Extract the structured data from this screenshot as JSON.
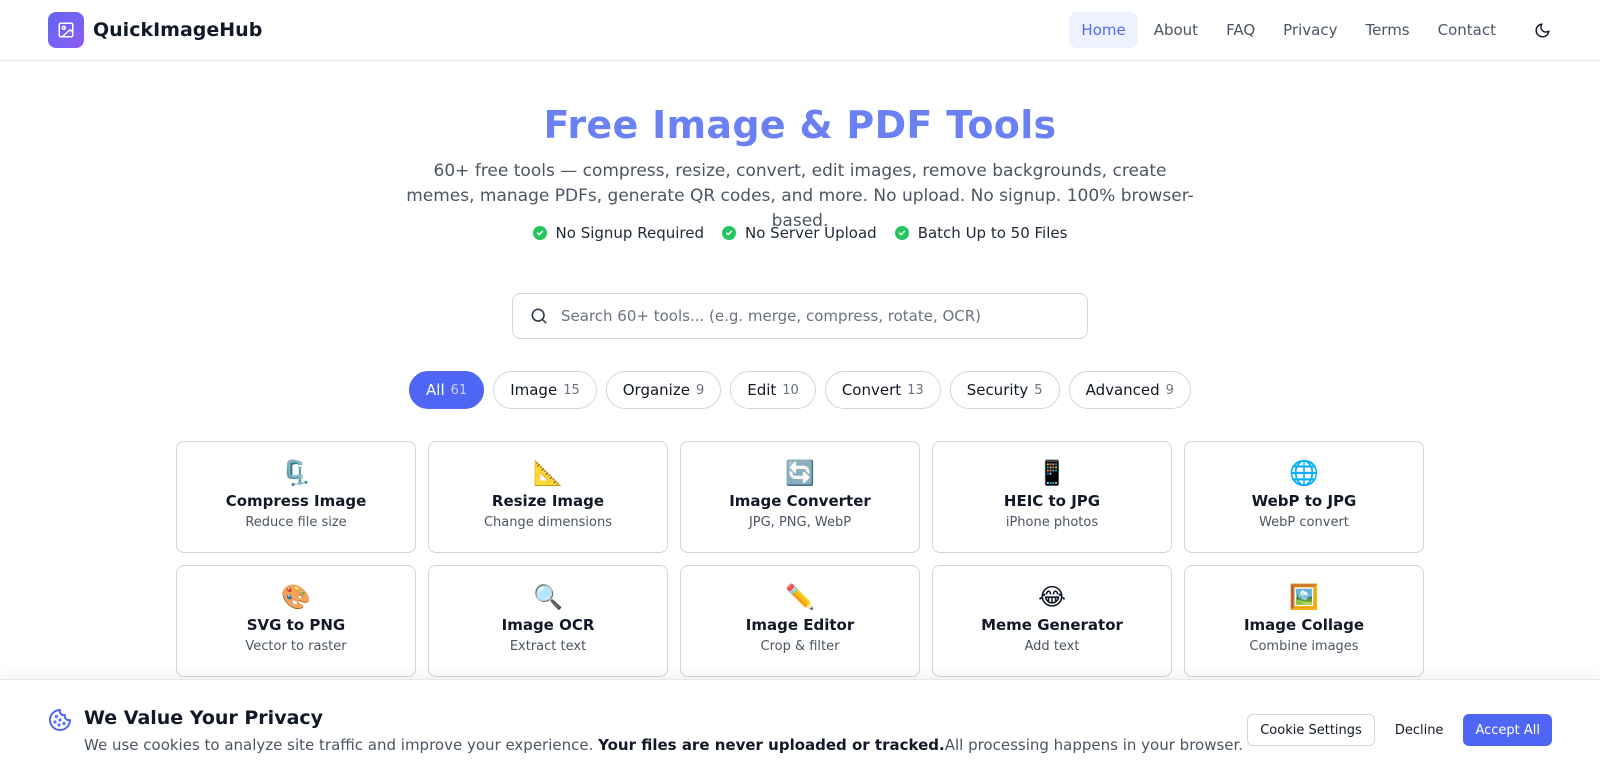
{
  "header": {
    "brand": "QuickImageHub",
    "nav": [
      {
        "label": "Home",
        "active": true
      },
      {
        "label": "About"
      },
      {
        "label": "FAQ"
      },
      {
        "label": "Privacy"
      },
      {
        "label": "Terms"
      },
      {
        "label": "Contact"
      }
    ],
    "theme_toggle_icon": "moon-icon"
  },
  "hero": {
    "title": "Free Image & PDF Tools",
    "subtitle": "60+ free tools — compress, resize, convert, edit images, remove backgrounds, create memes, manage PDFs, generate QR codes, and more. No upload. No signup. 100% browser-based.",
    "features": [
      "No Signup Required",
      "No Server Upload",
      "Batch Up to 50 Files"
    ]
  },
  "search": {
    "placeholder": "Search 60+ tools... (e.g. merge, compress, rotate, OCR)",
    "value": ""
  },
  "categories": [
    {
      "label": "All",
      "count": "61",
      "active": true
    },
    {
      "label": "Image",
      "count": "15"
    },
    {
      "label": "Organize",
      "count": "9"
    },
    {
      "label": "Edit",
      "count": "10"
    },
    {
      "label": "Convert",
      "count": "13"
    },
    {
      "label": "Security",
      "count": "5"
    },
    {
      "label": "Advanced",
      "count": "9"
    }
  ],
  "tools": [
    {
      "icon": "🗜️",
      "icon_name": "clamp-icon",
      "title": "Compress Image",
      "desc": "Reduce file size"
    },
    {
      "icon": "📐",
      "icon_name": "triangular-ruler-icon",
      "title": "Resize Image",
      "desc": "Change dimensions"
    },
    {
      "icon": "🔄",
      "icon_name": "arrows-cycle-icon",
      "title": "Image Converter",
      "desc": "JPG, PNG, WebP"
    },
    {
      "icon": "📱",
      "icon_name": "mobile-phone-icon",
      "title": "HEIC to JPG",
      "desc": "iPhone photos"
    },
    {
      "icon": "🌐",
      "icon_name": "globe-icon",
      "title": "WebP to JPG",
      "desc": "WebP convert"
    },
    {
      "icon": "🎨",
      "icon_name": "palette-icon",
      "title": "SVG to PNG",
      "desc": "Vector to raster"
    },
    {
      "icon": "🔍",
      "icon_name": "magnifier-icon",
      "title": "Image OCR",
      "desc": "Extract text"
    },
    {
      "icon": "✏️",
      "icon_name": "pencil-icon",
      "title": "Image Editor",
      "desc": "Crop & filter"
    },
    {
      "icon": "😂",
      "icon_name": "laughing-face-icon",
      "title": "Meme Generator",
      "desc": "Add text"
    },
    {
      "icon": "🖼️",
      "icon_name": "framed-picture-icon",
      "title": "Image Collage",
      "desc": "Combine images"
    }
  ],
  "cookie": {
    "title": "We Value Your Privacy",
    "text_before": "We use cookies to analyze site traffic and improve your experience. ",
    "text_bold": "Your files are never uploaded or tracked.",
    "text_after": "All processing happens in your browser.",
    "settings_label": "Cookie Settings",
    "decline_label": "Decline",
    "accept_label": "Accept All"
  },
  "colors": {
    "accent": "#4f66f5",
    "title_gradient": "#6a80f3",
    "check_green": "#22c55e"
  }
}
